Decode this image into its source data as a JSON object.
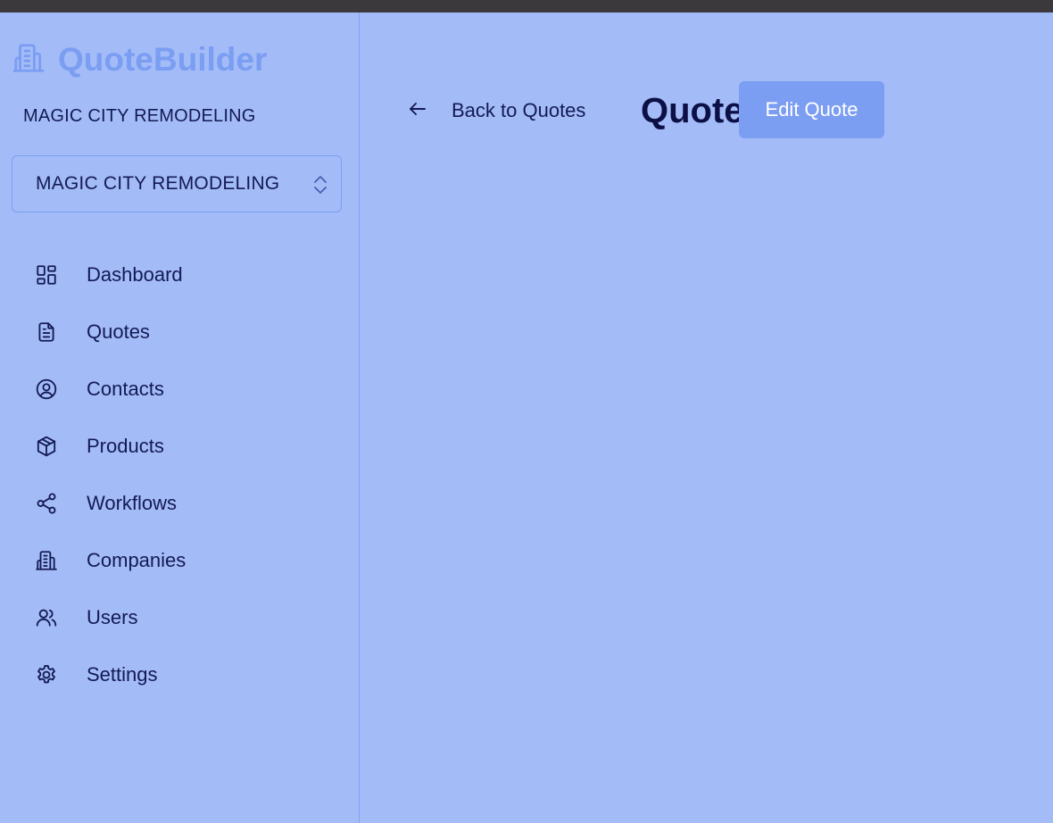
{
  "app": {
    "brand_name": "QuoteBuilder",
    "brand_icon": "building-icon",
    "colors": {
      "background": "#a3bcf8",
      "brand": "#7b9df2",
      "text": "#141a54",
      "title": "#0c1045",
      "button_text": "#ffffff"
    }
  },
  "sidebar": {
    "company_label": "MAGIC CITY REMODELING",
    "company_select": {
      "selected": "MAGIC CITY REMODELING",
      "icon": "chevron-up-down-icon"
    },
    "items": [
      {
        "label": "Dashboard",
        "icon": "dashboard-icon"
      },
      {
        "label": "Quotes",
        "icon": "document-icon"
      },
      {
        "label": "Contacts",
        "icon": "user-circle-icon"
      },
      {
        "label": "Products",
        "icon": "cube-icon"
      },
      {
        "label": "Workflows",
        "icon": "share-icon"
      },
      {
        "label": "Companies",
        "icon": "building-icon"
      },
      {
        "label": "Users",
        "icon": "users-icon"
      },
      {
        "label": "Settings",
        "icon": "gear-icon"
      }
    ]
  },
  "main": {
    "back_label": "Back to Quotes",
    "back_icon": "arrow-left-icon",
    "title": "Quote",
    "edit_button": "Edit Quote"
  }
}
